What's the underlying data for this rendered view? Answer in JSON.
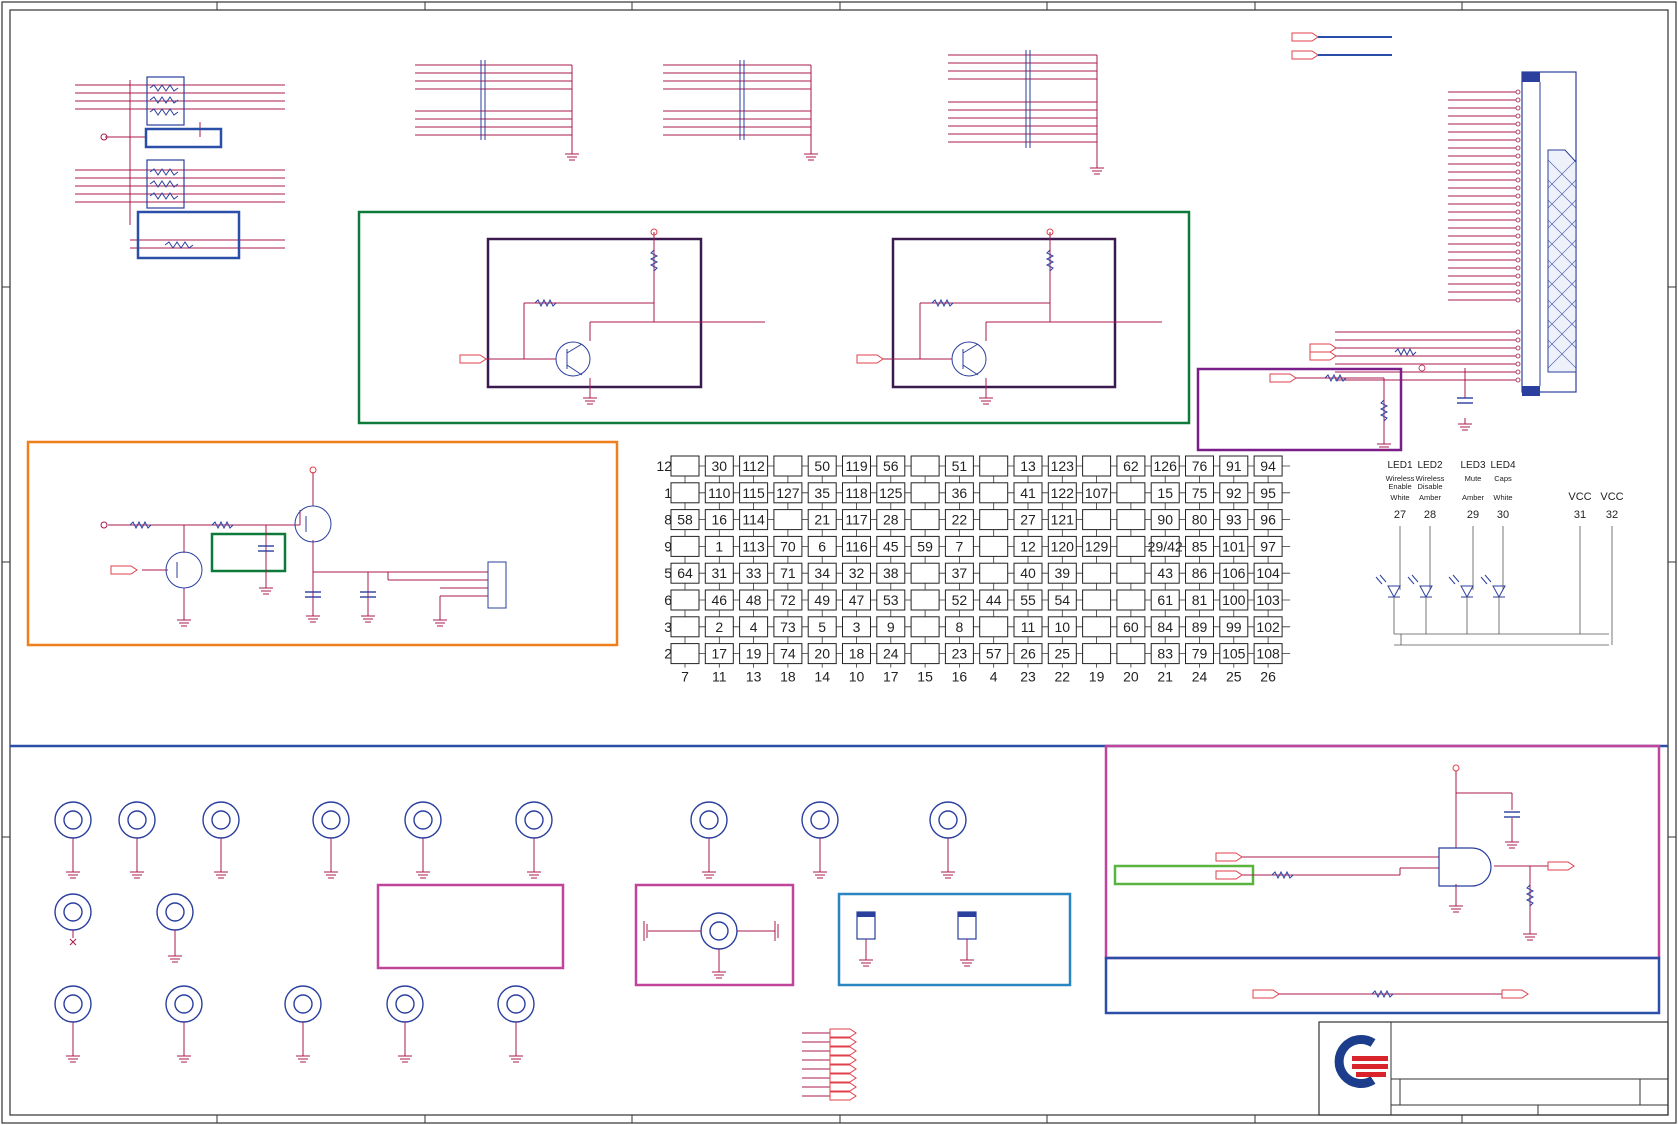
{
  "keyboard_matrix": {
    "row_labels": [
      "12",
      "1",
      "8",
      "9",
      "5",
      "6",
      "3",
      "2"
    ],
    "cells": [
      [
        "",
        "30",
        "112",
        "",
        "50",
        "119",
        "56",
        "",
        "51",
        "",
        "13",
        "123",
        "",
        "62",
        "126",
        "76",
        "91",
        "94"
      ],
      [
        "",
        "110",
        "115",
        "127",
        "35",
        "118",
        "125",
        "",
        "36",
        "",
        "41",
        "122",
        "107",
        "",
        "15",
        "75",
        "92",
        "95"
      ],
      [
        "58",
        "16",
        "114",
        "",
        "21",
        "117",
        "28",
        "",
        "22",
        "",
        "27",
        "121",
        "",
        "",
        "90",
        "80",
        "93",
        "96"
      ],
      [
        "",
        "1",
        "113",
        "70",
        "6",
        "116",
        "45",
        "59",
        "7",
        "",
        "12",
        "120",
        "129",
        "",
        "29/42",
        "85",
        "101",
        "97"
      ],
      [
        "64",
        "31",
        "33",
        "71",
        "34",
        "32",
        "38",
        "",
        "37",
        "",
        "40",
        "39",
        "",
        "",
        "43",
        "86",
        "106",
        "104"
      ],
      [
        "",
        "46",
        "48",
        "72",
        "49",
        "47",
        "53",
        "",
        "52",
        "44",
        "55",
        "54",
        "",
        "",
        "61",
        "81",
        "100",
        "103"
      ],
      [
        "",
        "2",
        "4",
        "73",
        "5",
        "3",
        "9",
        "",
        "8",
        "",
        "11",
        "10",
        "",
        "60",
        "84",
        "89",
        "99",
        "102"
      ],
      [
        "",
        "17",
        "19",
        "74",
        "20",
        "18",
        "24",
        "",
        "23",
        "57",
        "26",
        "25",
        "",
        "",
        "83",
        "79",
        "105",
        "108"
      ]
    ],
    "column_labels": [
      "7",
      "11",
      "13",
      "18",
      "14",
      "10",
      "17",
      "15",
      "16",
      "4",
      "23",
      "22",
      "19",
      "20",
      "21",
      "24",
      "25",
      "26"
    ]
  },
  "leds": {
    "items": [
      {
        "name": "LED1",
        "desc1": "Wireless",
        "desc2": "Enable",
        "color": "White",
        "pin": "27"
      },
      {
        "name": "LED2",
        "desc1": "Wireless",
        "desc2": "Disable",
        "color": "Amber",
        "pin": "28"
      },
      {
        "name": "LED3",
        "desc1": "Mute",
        "desc2": "",
        "color": "Amber",
        "pin": "29"
      },
      {
        "name": "LED4",
        "desc1": "Caps",
        "desc2": "",
        "color": "White",
        "pin": "30"
      }
    ],
    "vcc": [
      {
        "label": "VCC",
        "pin": "31"
      },
      {
        "label": "VCC",
        "pin": "32"
      }
    ]
  },
  "colors": {
    "wire": "#a8184f",
    "component": "#2a3f9e",
    "green_box": "#0d7a3a",
    "orange_box": "#f07e1b",
    "purple_box": "#7a1f8a",
    "magenta_box": "#c0449a",
    "cyan_box": "#2a86c0",
    "divider": "#2a4fa8"
  }
}
